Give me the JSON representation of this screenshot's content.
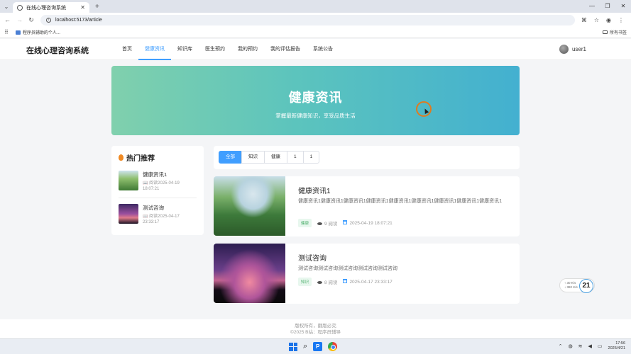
{
  "browser": {
    "tab_title": "在线心理咨询系统",
    "new_tab": "+",
    "url": "localhost:5173/article",
    "bookmark": "程序员辅助的个人...",
    "bookmarks_folder": "所有书签",
    "win_min": "—",
    "win_max": "❐",
    "win_close": "✕"
  },
  "header": {
    "logo": "在线心理咨询系统",
    "menu": [
      "首页",
      "健康资讯",
      "知识库",
      "医生预约",
      "我的预约",
      "我的评估报告",
      "系统公告"
    ],
    "active_menu_index": 1,
    "username": "user1"
  },
  "banner": {
    "title": "健康资讯",
    "subtitle": "掌握最新健康知识，享受品质生活"
  },
  "sidebar": {
    "title": "热门推荐",
    "items": [
      {
        "title": "健康资讯1",
        "meta": "阅读2025-04-19 18:07:21"
      },
      {
        "title": "测试咨询",
        "meta": "阅读2025-04-17 23:33:17"
      }
    ]
  },
  "filters": {
    "chips": [
      "全部",
      "知识",
      "健康",
      "1",
      "1"
    ],
    "active_index": 0
  },
  "articles": [
    {
      "title": "健康资讯1",
      "excerpt": "健康资讯1健康资讯1健康资讯1健康资讯1健康资讯1健康资讯1健康资讯1健康资讯1健康资讯1",
      "tag": "健康",
      "views": "9 阅读",
      "date": "2025-04-19 18:07:21"
    },
    {
      "title": "测试咨询",
      "excerpt": "测试咨询测试咨询测试咨询测试咨询测试咨询",
      "tag": "知识",
      "views": "8 阅读",
      "date": "2025-04-17 23:33:17"
    }
  ],
  "footer": {
    "line1": "版权所有，翻版必究",
    "line2": "©2025 B站：程序员辅导"
  },
  "net_widget": {
    "up": "↑ 30 K/s",
    "down": "↓ 382 K/s",
    "value": "21"
  },
  "taskbar": {
    "time": "17:56",
    "date": "2025/4/21"
  },
  "colors": {
    "accent": "#409eff",
    "banner_start": "#80d0ad",
    "banner_end": "#43b0d0"
  }
}
